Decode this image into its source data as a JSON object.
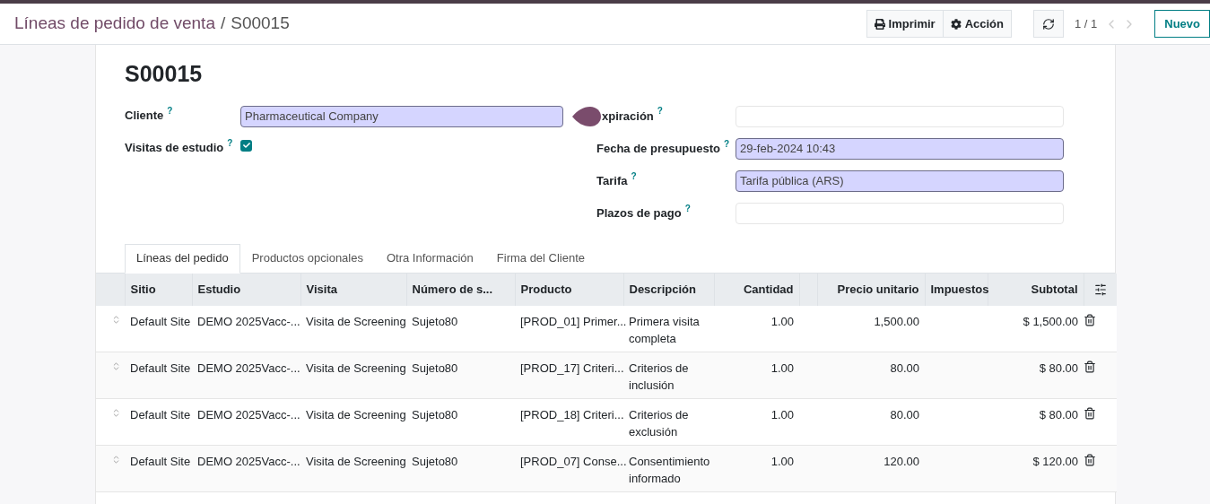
{
  "breadcrumb": {
    "parent": "Líneas de pedido de venta",
    "separator": "/",
    "current": "S00015"
  },
  "toolbar": {
    "buttons": [
      "Imprimir",
      "Acción"
    ],
    "pager": "1 / 1",
    "new_button": "Nuevo"
  },
  "record": {
    "title": "S00015"
  },
  "left_fields": [
    {
      "kind": "input",
      "label": "Cliente",
      "help": "?",
      "value": "Pharmaceutical Company",
      "highlighted": true
    },
    {
      "kind": "checkbox",
      "label": "Visitas de estudio",
      "help": "?",
      "checked": true
    }
  ],
  "right_fields": [
    {
      "label": "xpiración",
      "help": "?",
      "highlighted": false,
      "covered": true
    },
    {
      "label": "Fecha de presupuesto",
      "help": "?",
      "value": "29-feb-2024 10:43",
      "highlighted": true,
      "covered": false
    },
    {
      "label": "Tarifa",
      "help": "?",
      "value": "Tarifa pública (ARS)",
      "highlighted": true,
      "covered": false
    },
    {
      "label": "Plazos de pago",
      "help": "?",
      "highlighted": false,
      "covered": false
    }
  ],
  "tabs": [
    {
      "label": "Líneas del pedido",
      "selected": true
    },
    {
      "label": "Productos opcionales",
      "selected": false
    },
    {
      "label": "Otra Información",
      "selected": false
    },
    {
      "label": "Firma del Cliente",
      "selected": false
    }
  ],
  "table": {
    "columns": [
      "Sitio",
      "Estudio",
      "Visita",
      "Número de s...",
      "Producto",
      "Descripción",
      "Cantidad",
      "Precio unitario",
      "Impuestos",
      "Subtotal"
    ],
    "rows": [
      {
        "cells": [
          "Default Site",
          "DEMO 2025Vacc-...",
          "Visita de Screening",
          "Sujeto80",
          "[PROD_01] Primer...",
          "Primera visita completa",
          "1.00",
          "1,500.00",
          "",
          "$ 1,500.00"
        ]
      },
      {
        "cells": [
          "Default Site",
          "DEMO 2025Vacc-...",
          "Visita de Screening",
          "Sujeto80",
          "[PROD_17] Criteri...",
          "Criterios de inclusión",
          "1.00",
          "80.00",
          "",
          "$ 80.00"
        ]
      },
      {
        "cells": [
          "Default Site",
          "DEMO 2025Vacc-...",
          "Visita de Screening",
          "Sujeto80",
          "[PROD_18] Criteri...",
          "Criterios de exclusión",
          "1.00",
          "80.00",
          "",
          "$ 80.00"
        ]
      },
      {
        "cells": [
          "Default Site",
          "DEMO 2025Vacc-...",
          "Visita de Screening",
          "Sujeto80",
          "[PROD_07] Conse...",
          "Consentimiento informado",
          "1.00",
          "120.00",
          "",
          "$ 120.00"
        ]
      }
    ]
  }
}
